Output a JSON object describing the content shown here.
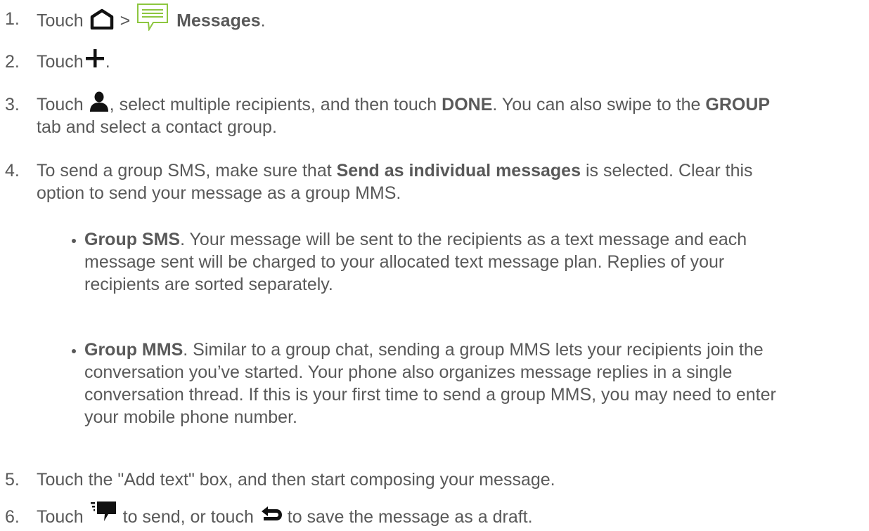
{
  "steps": [
    {
      "number": "1.",
      "parts": {
        "a": "Touch",
        "b": ">",
        "c": "Messages",
        "d": "."
      },
      "icons": [
        "home-icon",
        "messages-app-icon"
      ]
    },
    {
      "number": "2.",
      "parts": {
        "a": "Touch",
        "b": "."
      },
      "icons": [
        "plus-icon"
      ]
    },
    {
      "number": "3.",
      "parts": {
        "a": "Touch",
        "b": ", select multiple recipients, and then touch ",
        "c": "DONE",
        "d": ". You can also swipe to the ",
        "e": "GROUP",
        "f": "tab and select a contact group."
      },
      "icons": [
        "person-icon"
      ]
    },
    {
      "number": "4.",
      "parts": {
        "a": "To send a group SMS, make sure that ",
        "b": "Send as individual messages",
        "c": " is selected. Clear this",
        "d": "option to send your message as a group MMS."
      }
    },
    {
      "number": "5.",
      "parts": {
        "a": "Touch the \"Add text\" box, and then start composing your message."
      }
    },
    {
      "number": "6.",
      "parts": {
        "a": "Touch",
        "b": "to send, or touch",
        "c": "to save the message as a draft."
      },
      "icons": [
        "send-message-icon",
        "back-icon"
      ]
    }
  ],
  "bullets": [
    {
      "term": "Group SMS",
      "lines": [
        ". Your message will be sent to the recipients as a text message and each",
        "message sent will be charged to your allocated text message plan. Replies of your",
        "recipients are sorted separately."
      ]
    },
    {
      "term": "Group MMS",
      "lines": [
        ". Similar to a group chat, sending a group MMS lets your recipients join the",
        "conversation you’ve started. Your phone also organizes message replies in a single",
        "conversation thread. If this is your first time to send a group MMS, you may need to enter",
        "your mobile phone number."
      ]
    }
  ],
  "colors": {
    "text": "#595959",
    "icon_dark": "#111111",
    "messages_green": "#8dc63f"
  }
}
